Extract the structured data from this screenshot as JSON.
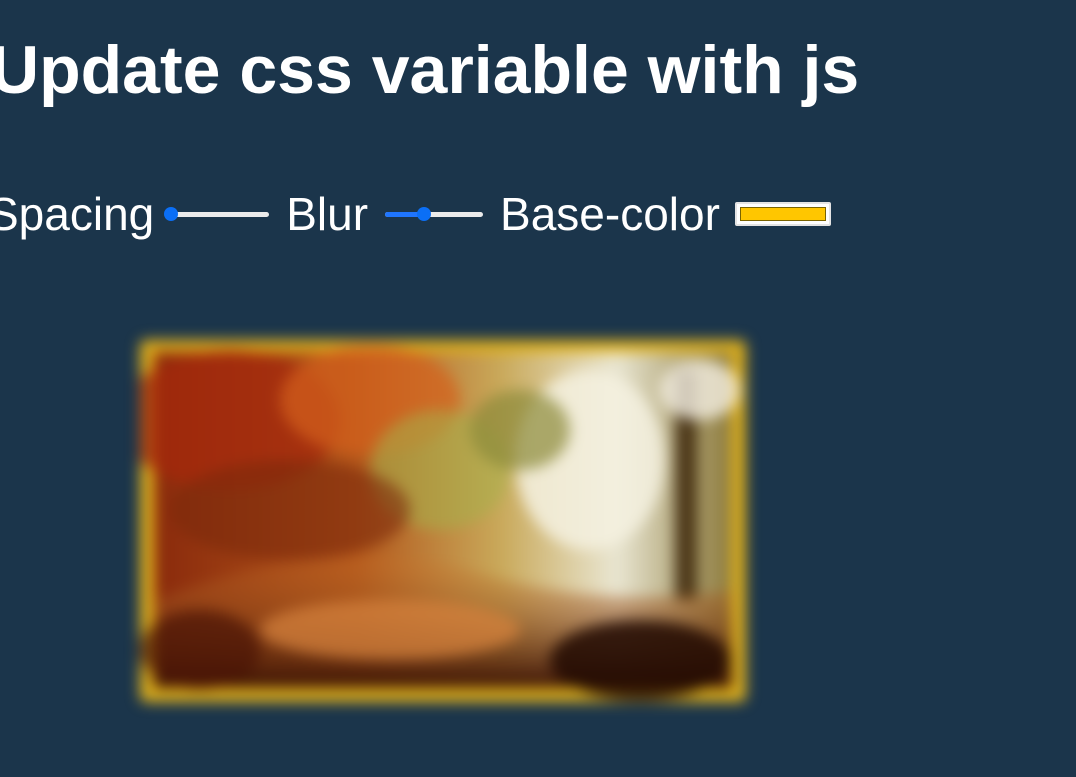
{
  "page": {
    "title": "Update css variable with js"
  },
  "controls": {
    "spacing": {
      "label": "Spacing",
      "value": 0
    },
    "blur": {
      "label": "Blur",
      "value": 0.4
    },
    "base_color": {
      "label": "Base-color",
      "value": "#ffc600"
    }
  },
  "colors": {
    "background": "#1b354b",
    "accent": "#1f75fe",
    "base": "#ffc600"
  },
  "image": {
    "icon": "forest-photo"
  }
}
